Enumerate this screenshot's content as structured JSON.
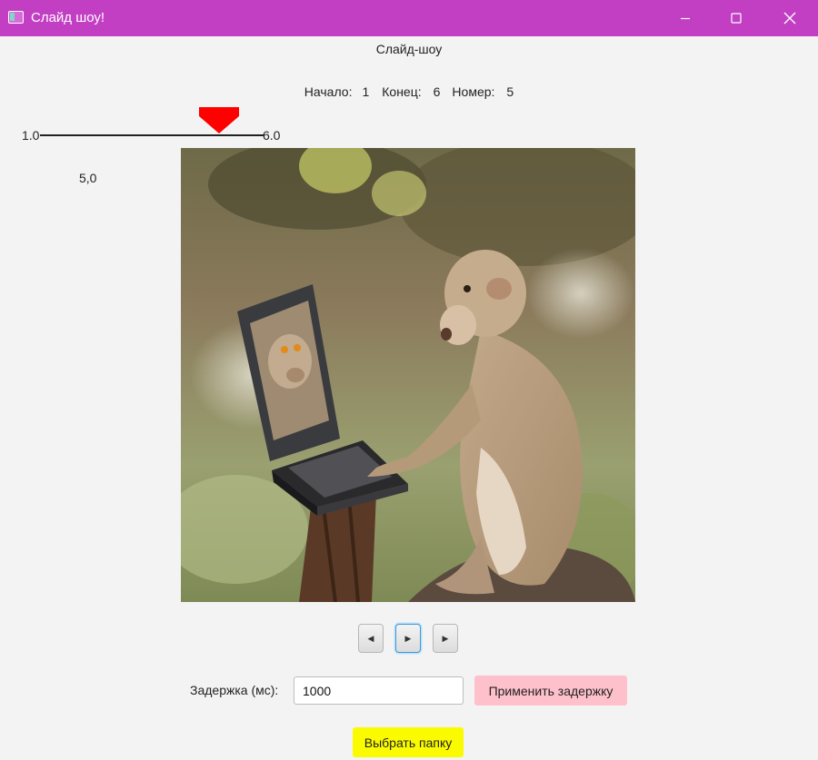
{
  "window": {
    "title": "Слайд шоу!",
    "titlebar_color": "#c23fc4",
    "controls": [
      "minimize-icon",
      "maximize-icon",
      "close-icon"
    ]
  },
  "header": {
    "title": "Слайд-шоу"
  },
  "info": {
    "start_label": "Начало:",
    "start_value": "1",
    "end_label": "Конец:",
    "end_value": "6",
    "number_label": "Номер:",
    "number_value": "5"
  },
  "slider": {
    "min_label": "1.0",
    "max_label": "6.0",
    "current_value_text": "5,0",
    "value": 5.0,
    "min": 1.0,
    "max": 6.0,
    "thumb_color": "#ff0000"
  },
  "image": {
    "description_icon": "slide-image"
  },
  "controls": {
    "prev_icon": "◀",
    "play_icon": "▶",
    "next_icon": "▶"
  },
  "delay": {
    "label": "Задержка (мс):",
    "value": "1000",
    "apply_label": "Применить задержку",
    "apply_color": "#fec0cb"
  },
  "folder": {
    "label": "Выбрать папку",
    "color": "#fbfb00"
  }
}
